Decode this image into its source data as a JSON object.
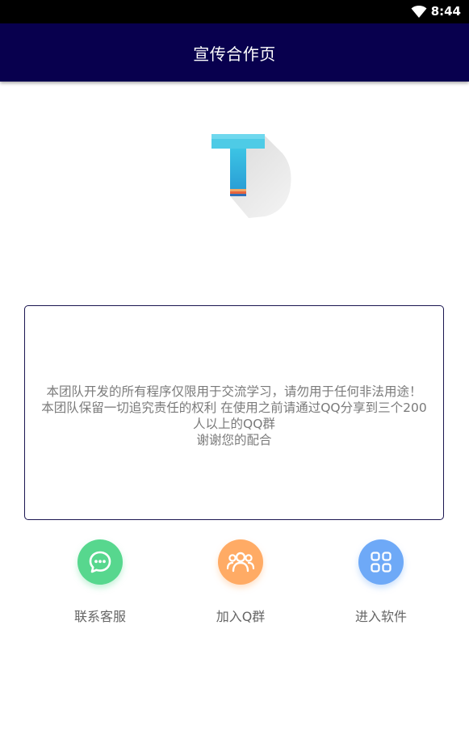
{
  "status_bar": {
    "time": "8:44",
    "wifi_icon": "wifi-icon"
  },
  "app_bar": {
    "title": "宣传合作页"
  },
  "logo": {
    "icon": "t-logo-icon",
    "colors": [
      "#4ecbe6",
      "#2fa6d8",
      "#e8643c"
    ]
  },
  "notice": {
    "lines": [
      "本团队开发的所有程序仅限用于交流学习，请勿用于任何非法用途！",
      "本团队保留一切追究责任的权利 在使用之前请通过QQ分享到三个200",
      "人以上的QQ群",
      "谢谢您的配合"
    ],
    "border_color": "#1a1550"
  },
  "actions": [
    {
      "label": "联系客服",
      "icon": "chat-bubble-icon",
      "color": "#57d78e"
    },
    {
      "label": "加入Q群",
      "icon": "group-users-icon",
      "color": "#ffab65"
    },
    {
      "label": "进入软件",
      "icon": "apps-grid-icon",
      "color": "#6ea9f7"
    }
  ]
}
